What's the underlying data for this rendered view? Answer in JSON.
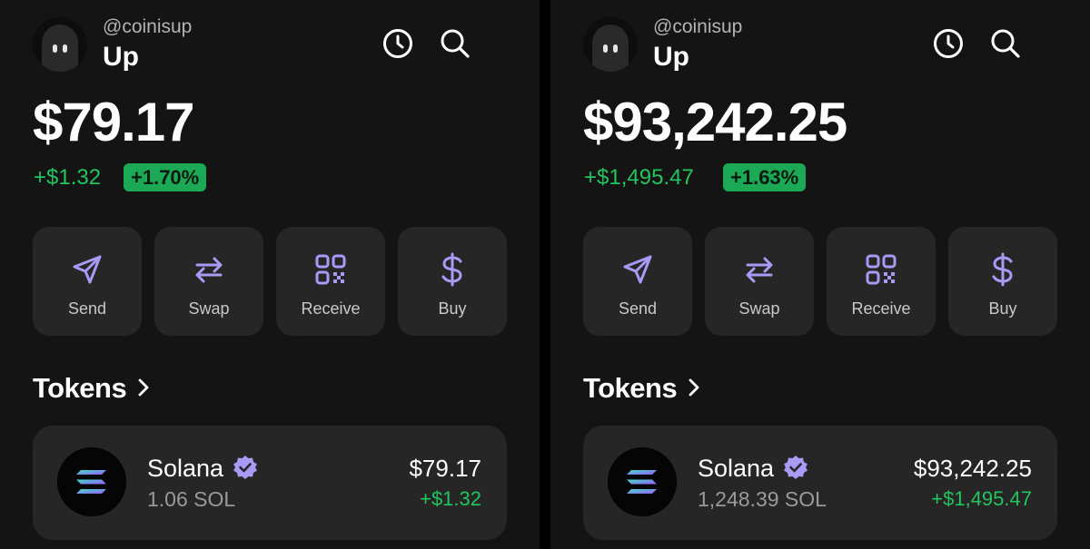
{
  "screens": [
    {
      "handle": "@coinisup",
      "account_name": "Up",
      "balance": "$79.17",
      "change_amount": "+$1.32",
      "change_percent": "+1.70%",
      "actions": [
        "Send",
        "Swap",
        "Receive",
        "Buy"
      ],
      "tokens_heading": "Tokens",
      "token": {
        "name": "Solana",
        "amount": "1.06 SOL",
        "value": "$79.17",
        "change": "+$1.32"
      }
    },
    {
      "handle": "@coinisup",
      "account_name": "Up",
      "balance": "$93,242.25",
      "change_amount": "+$1,495.47",
      "change_percent": "+1.63%",
      "actions": [
        "Send",
        "Swap",
        "Receive",
        "Buy"
      ],
      "tokens_heading": "Tokens",
      "token": {
        "name": "Solana",
        "amount": "1,248.39 SOL",
        "value": "$93,242.25",
        "change": "+$1,495.47"
      }
    }
  ],
  "colors": {
    "background": "#141414",
    "card": "#262626",
    "accent_purple": "#a89af5",
    "positive_green": "#22c55e",
    "badge_green": "#1ca956"
  },
  "icons": {
    "top": [
      "history-icon",
      "search-icon"
    ],
    "actions": [
      "send-icon",
      "swap-icon",
      "qr-code-icon",
      "dollar-icon"
    ]
  }
}
